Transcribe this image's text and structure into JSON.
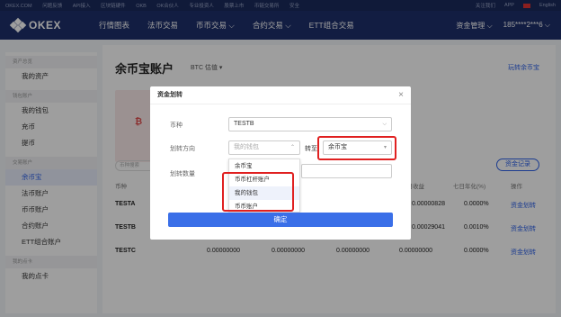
{
  "topbar": {
    "links": [
      "OKEX.COM",
      "问题反馈",
      "API接入",
      "区块链硬件",
      "OKB",
      "OK合伙人",
      "专业投资人",
      "股票上市",
      "币链交易所",
      "安全"
    ],
    "right": [
      "关注我们",
      "APP",
      "English"
    ]
  },
  "nav": {
    "logo": "OKEX",
    "items": [
      "行情图表",
      "法币交易",
      "币币交易 ⌵",
      "合约交易 ⌵",
      "ETT组合交易"
    ],
    "asset_mgmt": "资金管理 ⌵",
    "user": "185****2***6 ⌵"
  },
  "sidebar": {
    "groups": [
      {
        "head": "资产总览",
        "items": [
          "我的资产"
        ]
      },
      {
        "head": "钱包账户",
        "items": [
          "我的钱包",
          "充币",
          "提币"
        ]
      },
      {
        "head": "交易账户",
        "items": [
          "余币宝",
          "法币账户",
          "币币账户",
          "合约账户",
          "ETT组合账户"
        ]
      },
      {
        "head": "我的点卡",
        "items": [
          "我的点卡"
        ]
      }
    ],
    "active": "余币宝"
  },
  "main": {
    "title": "余币宝账户",
    "valuation": "BTC 估值 ▾",
    "transfer_link": "玩转余币宝",
    "card_symbol": "₿",
    "search_placeholder": "币种搜索",
    "record_button": "资金记录"
  },
  "table": {
    "headers": [
      "币种",
      "",
      "",
      "",
      "昨日收益",
      "七日年化(%)",
      "操作"
    ],
    "rows": [
      {
        "sym": "TESTA",
        "c1": "",
        "c2": "",
        "c3": "",
        "c4": "0.00000828",
        "c5": "0.0000%",
        "op": "资金划转"
      },
      {
        "sym": "TESTB",
        "c1": "",
        "c2": "",
        "c3": "",
        "c4": "0.00029041",
        "c5": "0.0010%",
        "op": "资金划转"
      },
      {
        "sym": "TESTC",
        "c1": "0.00000000",
        "c2": "0.00000000",
        "c3": "0.00000000",
        "c4": "0.00000000",
        "c5": "0.0000%",
        "op": "资金划转"
      }
    ]
  },
  "dialog": {
    "title": "资金划转",
    "close": "×",
    "coin_label": "币种",
    "coin_value": "TESTB",
    "direction_label": "划转方向",
    "from_placeholder": "我的钱包",
    "to_label": "转至",
    "to_value": "余币宝",
    "amount_label": "划转数量",
    "dropdown_options": [
      "余币宝",
      "币币杠杆账户",
      "我的钱包",
      "币币账户"
    ],
    "dropdown_selected": "我的钱包",
    "confirm": "确定"
  },
  "colors": {
    "nav_bg": "#1e2f6b",
    "accent": "#2e62e8",
    "highlight": "#e02020"
  }
}
